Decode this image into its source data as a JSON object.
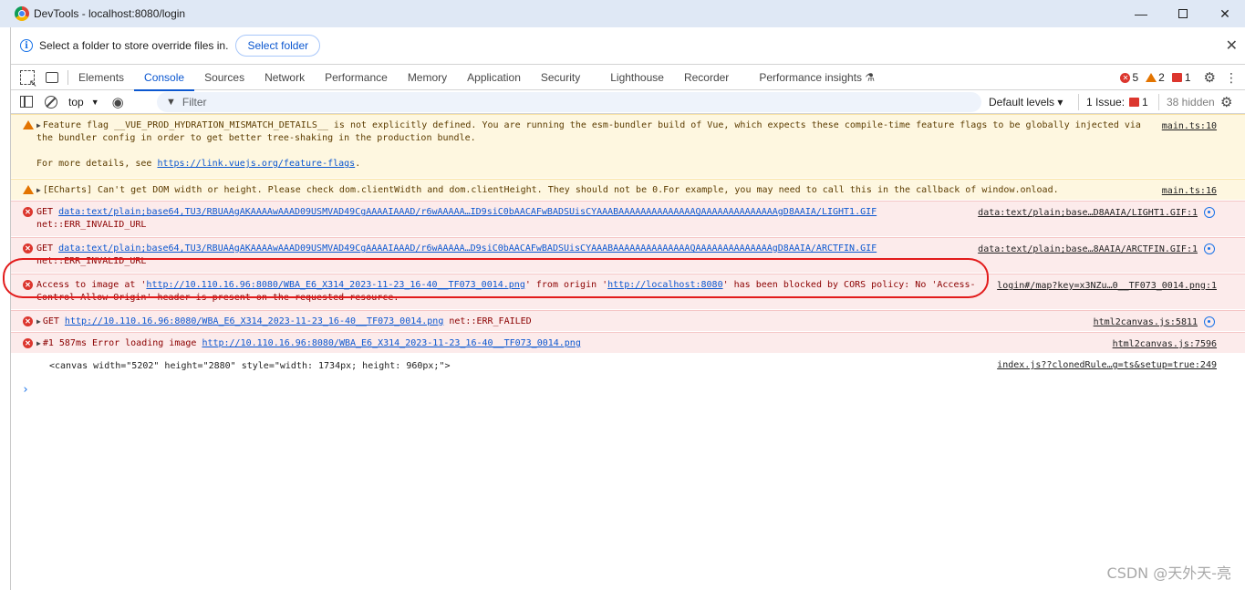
{
  "window": {
    "title": "DevTools - localhost:8080/login",
    "minimize": "—",
    "close": "✕"
  },
  "infobar": {
    "message": "Select a folder to store override files in.",
    "button": "Select folder",
    "close": "✕"
  },
  "tabs": [
    "Elements",
    "Console",
    "Sources",
    "Network",
    "Performance",
    "Memory",
    "Application",
    "Security",
    "Lighthouse",
    "Recorder",
    "Performance insights ⚗"
  ],
  "active_tab": "Console",
  "counts": {
    "errors": "5",
    "warnings": "2",
    "issues": "1"
  },
  "toolbar": {
    "context": "top",
    "filter_placeholder": "Filter",
    "levels": "Default levels ▾",
    "issues_label": "1 Issue:",
    "issues_count": "1",
    "hidden": "38 hidden"
  },
  "messages": [
    {
      "level": "warn",
      "line1": "Feature flag __VUE_PROD_HYDRATION_MISMATCH_DETAILS__ is not explicitly defined. You are running the esm-bundler build of Vue, which expects these compile-time feature flags to be globally injected via",
      "line2": "the bundler config in order to get better tree-shaking in the production bundle.",
      "line3_prefix": "For more details, see ",
      "line3_link": "https://link.vuejs.org/feature-flags",
      "line3_suffix": ".",
      "source": "main.ts:10"
    },
    {
      "level": "warn",
      "text": "[ECharts] Can't get DOM width or height. Please check dom.clientWidth and dom.clientHeight. They should not be 0.For example, you may need to call this in the callback of window.onload.",
      "source": "main.ts:16"
    },
    {
      "level": "error",
      "prefix": "GET ",
      "link": "data:text/plain;base64,TU3/RBUAAgAKAAAAwAAAD09USMVAD49CgAAAAIAAAD/r6wAAAAA…ID9siC0bAACAFwBADSUisCYAAABAAAAAAAAAAAAAAQAAAAAAAAAAAAAAgD8AAIA/LIGHT1.GIF",
      "line2": "net::ERR_INVALID_URL",
      "source": "data:text/plain;base…D8AAIA/LIGHT1.GIF:1"
    },
    {
      "level": "error",
      "prefix": "GET ",
      "link": "data:text/plain;base64,TU3/RBUAAgAKAAAAwAAAD09USMVAD49CgAAAAIAAAD/r6wAAAAA…D9siC0bAACAFwBADSUisCYAAABAAAAAAAAAAAAAAQAAAAAAAAAAAAAAgD8AAIA/ARCTFIN.GIF",
      "line2": "net::ERR_INVALID_URL",
      "source": "data:text/plain;base…8AAIA/ARCTFIN.GIF:1"
    },
    {
      "level": "error",
      "part1": "Access to image at '",
      "link1": "http://10.110.16.96:8080/WBA_E6_X314_2023-11-23_16-40__TF073_0014.png",
      "part2": "' from origin '",
      "link2": "http://localhost:8080",
      "part3": "' has been blocked by CORS policy: No 'Access-",
      "line2": "Control-Allow-Origin' header is present on the requested resource.",
      "source": "login#/map?key=x3NZu…0__TF073_0014.png:1"
    },
    {
      "level": "error",
      "prefix": "GET ",
      "link": "http://10.110.16.96:8080/WBA_E6_X314_2023-11-23_16-40__TF073_0014.png",
      "suffix": " net::ERR_FAILED",
      "source": "html2canvas.js:5811"
    },
    {
      "level": "error",
      "prefix": "#1 587ms Error loading image ",
      "link": "http://10.110.16.96:8080/WBA_E6_X314_2023-11-23_16-40__TF073_0014.png",
      "source": "html2canvas.js:7596"
    },
    {
      "level": "log",
      "text": "<canvas width=\"5202\" height=\"2880\" style=\"width: 1734px; height: 960px;\">",
      "source": "index.js??clonedRule…g=ts&setup=true:249"
    }
  ],
  "prompt": "›",
  "watermark": "CSDN @天外天-亮",
  "colors": {
    "accent": "#0b57d0",
    "error": "#dc362e",
    "warning": "#e37400",
    "annotation": "#e21b1b"
  }
}
